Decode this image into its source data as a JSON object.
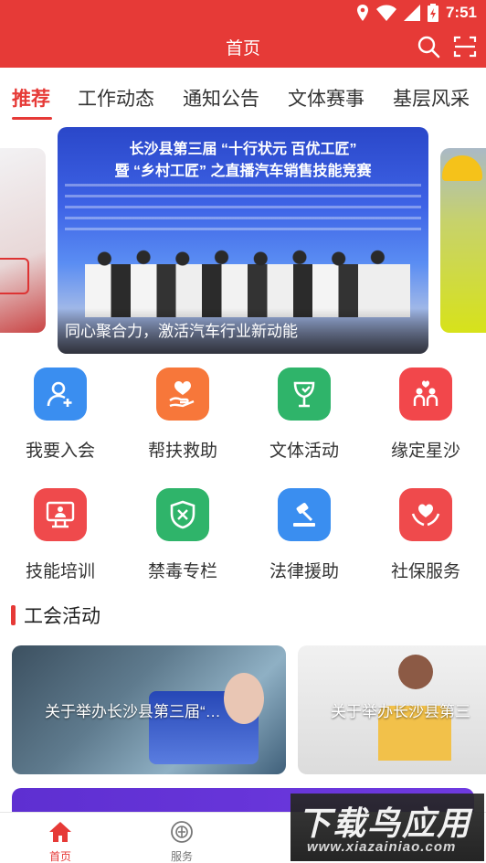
{
  "status_bar": {
    "time": "7:51"
  },
  "app_bar": {
    "title": "首页"
  },
  "tabs": [
    {
      "label": "推荐",
      "active": true
    },
    {
      "label": "工作动态",
      "active": false
    },
    {
      "label": "通知公告",
      "active": false
    },
    {
      "label": "文体赛事",
      "active": false
    },
    {
      "label": "基层风采",
      "active": false
    }
  ],
  "banner": {
    "headline_1": "长沙县第三届 “十行状元 百优工匠”",
    "headline_2": "暨 “乡村工匠” 之直播汽车销售技能竞赛",
    "caption": "同心聚合力，激活汽车行业新动能"
  },
  "services": [
    {
      "label": "我要入会",
      "icon": "user-add-icon",
      "color": "#3a8ef0"
    },
    {
      "label": "帮扶救助",
      "icon": "helping-hand-heart-icon",
      "color": "#f7773a"
    },
    {
      "label": "文体活动",
      "icon": "trophy-flag-icon",
      "color": "#2fb46a"
    },
    {
      "label": "缘定星沙",
      "icon": "couple-heart-icon",
      "color": "#f2474b"
    },
    {
      "label": "技能培训",
      "icon": "training-board-icon",
      "color": "#ef4a4c"
    },
    {
      "label": "禁毒专栏",
      "icon": "shield-icon",
      "color": "#2fb46a"
    },
    {
      "label": "法律援助",
      "icon": "gavel-icon",
      "color": "#3a8ef0"
    },
    {
      "label": "社保服务",
      "icon": "heart-hands-icon",
      "color": "#ef4a4c"
    }
  ],
  "union_activities": {
    "section_title": "工会活动",
    "cards": [
      {
        "title": "关于举办长沙县第三届“…"
      },
      {
        "title": "关于举办长沙县第三"
      }
    ]
  },
  "bottom_nav": [
    {
      "label": "首页",
      "icon": "home-icon",
      "active": true
    },
    {
      "label": "服务",
      "icon": "union-emblem-icon",
      "active": false
    }
  ],
  "watermark": {
    "line_1": "下载鸟应用",
    "line_2": "www.xiazainiao.com"
  },
  "colors": {
    "brand": "#e63a37"
  }
}
